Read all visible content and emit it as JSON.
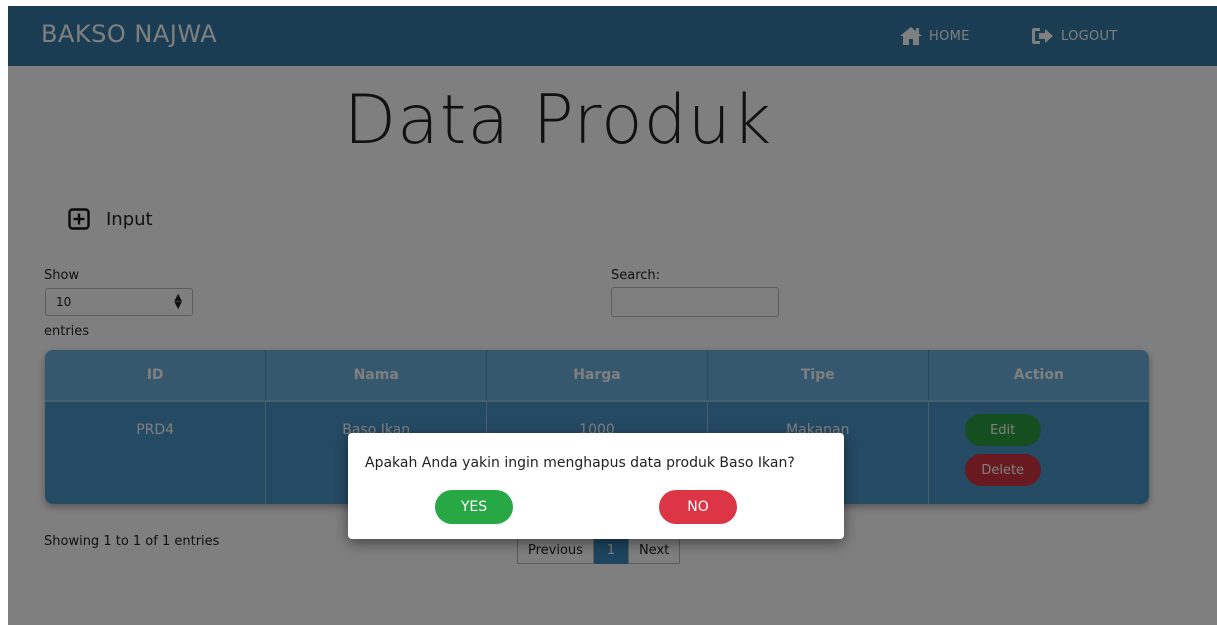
{
  "navbar": {
    "brand": "BAKSO NAJWA",
    "home_label": "HOME",
    "logout_label": "LOGOUT"
  },
  "page": {
    "title": "Data Produk",
    "input_label": "Input"
  },
  "controls": {
    "show_label": "Show",
    "entries_value": "10",
    "entries_label": "entries",
    "search_label": "Search:",
    "search_value": ""
  },
  "table": {
    "headers": [
      "ID",
      "Nama",
      "Harga",
      "Tipe",
      "Action"
    ],
    "rows": [
      {
        "id": "PRD4",
        "nama": "Baso Ikan",
        "harga": "1000",
        "tipe": "Makanan",
        "edit_label": "Edit",
        "delete_label": "Delete"
      }
    ]
  },
  "footer": {
    "showing": "Showing 1 to 1 of 1 entries",
    "previous": "Previous",
    "current_page": "1",
    "next": "Next"
  },
  "modal": {
    "message": "Apakah Anda yakin ingin menghapus data produk Baso Ikan?",
    "yes_label": "YES",
    "no_label": "NO"
  },
  "colors": {
    "navbar": "#357aa6",
    "table_header": "#6cb1dc",
    "table_body": "#4b95c8",
    "yes": "#28a745",
    "no": "#dc3545"
  }
}
